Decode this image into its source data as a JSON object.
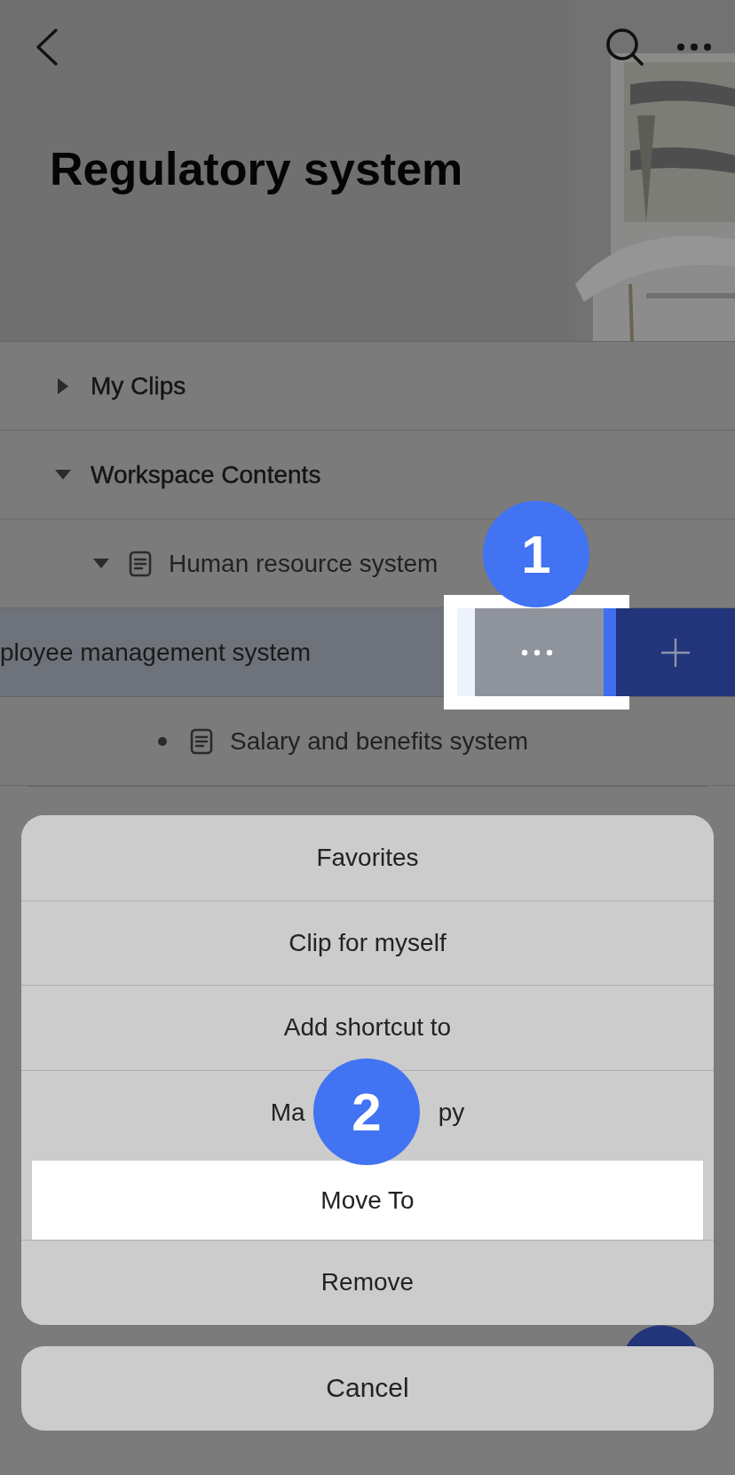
{
  "header": {
    "title": "Regulatory system"
  },
  "tree": [
    {
      "label": "My Clips",
      "kind": "section",
      "expanded": false
    },
    {
      "label": "Workspace Contents",
      "kind": "section",
      "expanded": true,
      "children": [
        {
          "label": "Human resource system",
          "kind": "document",
          "expanded": true,
          "children": [
            {
              "label": "ployee management system",
              "kind": "swiped",
              "actions": {
                "more_selected": true
              }
            },
            {
              "label": "Salary and benefits system",
              "kind": "bullet"
            }
          ]
        }
      ]
    }
  ],
  "callouts": [
    {
      "label": "1"
    },
    {
      "label": "2"
    }
  ],
  "action_sheet": {
    "items": [
      {
        "label": "Favorites",
        "highlighted": false
      },
      {
        "label": "Clip for myself",
        "highlighted": false
      },
      {
        "label": "Add shortcut to",
        "highlighted": false
      },
      {
        "label_parts": [
          "Ma",
          "py"
        ],
        "highlighted": false
      },
      {
        "label": "Move To",
        "highlighted": true
      },
      {
        "label": "Remove",
        "highlighted": false
      }
    ],
    "cancel": "Cancel"
  }
}
